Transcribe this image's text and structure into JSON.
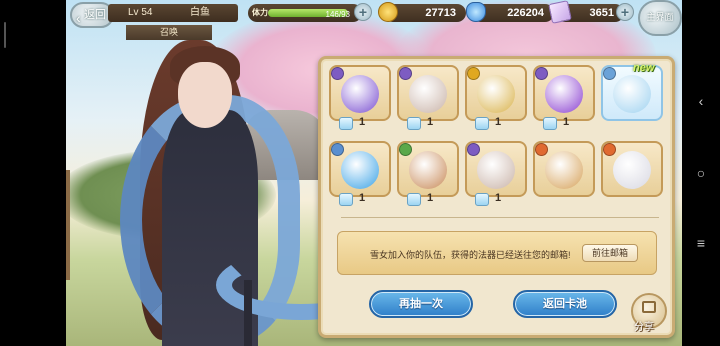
{
  "topbar": {
    "back_label": "返回",
    "level": "Lv 54",
    "player_name": "白鱼",
    "tab_label": "召唤",
    "stamina_label": "体力",
    "stamina_value": "146/93",
    "stamina_fraction": 1.0,
    "gold": "27713",
    "gems": "226204",
    "tickets": "3651",
    "main_label": "主界面"
  },
  "items": [
    {
      "name": "star-earrings",
      "count": "1",
      "rarity_color": "#7d5cc2",
      "art_color": "#7a4fd0"
    },
    {
      "name": "crystal-pendant",
      "count": "1",
      "rarity_color": "#7d5cc2",
      "art_color": "#c9b3a8"
    },
    {
      "name": "golden-crown",
      "count": "1",
      "rarity_color": "#e0a820",
      "art_color": "#d9b24a"
    },
    {
      "name": "purple-gourd",
      "count": "1",
      "rarity_color": "#7d5cc2",
      "art_color": "#8a3fd0"
    },
    {
      "name": "snowflake-charm",
      "count": "",
      "rarity_color": "#6aa2d8",
      "art_color": "#9fd2f0"
    },
    {
      "name": "blue-orb-amulet",
      "count": "1",
      "rarity_color": "#5a8fd0",
      "art_color": "#3aa2e6"
    },
    {
      "name": "bow",
      "count": "1",
      "rarity_color": "#5aa84a",
      "art_color": "#c88a58"
    },
    {
      "name": "crystal-pendant-2",
      "count": "1",
      "rarity_color": "#7d5cc2",
      "art_color": "#c9b3a8"
    },
    {
      "name": "character-card-compass",
      "count": "",
      "rarity_color": "#e06a30",
      "art_color": "#d6a25a"
    },
    {
      "name": "character-card-girl",
      "count": "",
      "rarity_color": "#e06a30",
      "art_color": "#d8d8e2"
    }
  ],
  "new_tag": "new",
  "message": "雪女加入你的队伍，获得的法器已经送往您的邮箱!",
  "mail_button": "前往邮箱",
  "again_button": "再抽一次",
  "return_button": "返回卡池",
  "share_label": "分享"
}
